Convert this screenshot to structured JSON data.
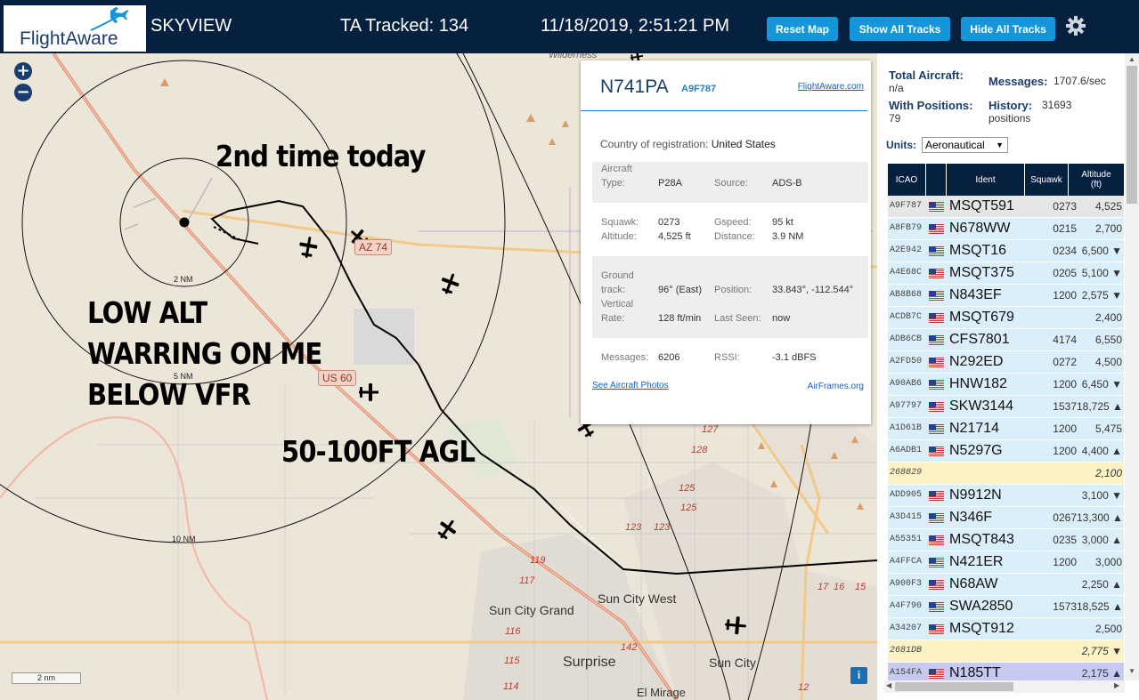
{
  "header": {
    "logo_text": "FlightAware",
    "title": "SKYVIEW",
    "tracked_label": "TA Tracked: 134",
    "datetime": "11/18/2019, 2:51:21 PM",
    "buttons": {
      "reset": "Reset Map",
      "show_all": "Show All Tracks",
      "hide_all": "Hide All Tracks"
    },
    "accent_color": "#1496d8",
    "bar_color": "#06203f"
  },
  "map": {
    "zoom_in": "+",
    "zoom_out": "−",
    "annotations": {
      "second_time": "2nd time today",
      "low_alt_1": "LOW ALT",
      "low_alt_2": "WARRING ON ME",
      "low_alt_3": "BELOW VFR",
      "agl": "50-100FT AGL"
    },
    "range_labels": {
      "r2": "2 NM",
      "r5": "5 NM",
      "r10": "10 NM"
    },
    "road_shields": {
      "az74": "AZ 74",
      "us60": "US 60"
    },
    "places": {
      "wilderness": "Wilderness",
      "sun_city_grand": "Sun City Grand",
      "sun_city_west": "Sun City West",
      "surprise": "Surprise",
      "sun_city": "Sun City",
      "el_mirage": "El Mirage"
    },
    "route_numbers": [
      "127",
      "128",
      "125",
      "125",
      "123",
      "123",
      "119",
      "117",
      "116",
      "115",
      "114",
      "142",
      "12",
      "17",
      "16",
      "15"
    ],
    "scale_label": "2 nm",
    "info_button": "i"
  },
  "popup": {
    "registration": "N741PA",
    "hex": "A9F787",
    "fa_link": "FlightAware.com",
    "country_label": "Country of registration:",
    "country_value": "United States",
    "aircraft_type_label_1": "Aircraft",
    "aircraft_type_label_2": "Type:",
    "aircraft_type": "P28A",
    "source_label": "Source:",
    "source": "ADS-B",
    "squawk_label": "Squawk:",
    "squawk": "0273",
    "gspeed_label": "Gspeed:",
    "gspeed": "95 kt",
    "altitude_label": "Altitude:",
    "altitude": "4,525 ft",
    "distance_label": "Distance:",
    "distance": "3.9 NM",
    "ground_label_1": "Ground",
    "ground_label_2": "track:",
    "ground_track": "96° (East)",
    "position_label": "Position:",
    "position": "33.843°, -112.544°",
    "vrate_label_1": "Vertical",
    "vrate_label_2": "Rate:",
    "vrate": "128 ft/min",
    "lastseen_label": "Last Seen:",
    "lastseen": "now",
    "messages_label": "Messages:",
    "messages": "6206",
    "rssi_label": "RSSI:",
    "rssi": "-3.1 dBFS",
    "photos_link": "See Aircraft Photos",
    "airframes_link": "AirFrames.org"
  },
  "sidebar": {
    "total_aircraft_label": "Total Aircraft:",
    "total_aircraft": "n/a",
    "messages_label": "Messages:",
    "messages": "1707.6/sec",
    "with_positions_label": "With Positions:",
    "with_positions": "79",
    "history_label": "History:",
    "history_1": "31693",
    "history_2": "positions",
    "units_label": "Units:",
    "units_value": "Aeronautical",
    "columns": {
      "icao": "ICAO",
      "ident": "Ident",
      "squawk": "Squawk",
      "alt_1": "Altitude",
      "alt_2": "(ft)"
    },
    "row_colors": {
      "default": "#dbeffb",
      "selected": "#e6e6e6",
      "no_position": "#fdf2c4",
      "highlight": "#c6c9f2"
    },
    "rows": [
      {
        "icao": "A9F787",
        "ident": "MSQT591",
        "squawk": "0273",
        "alt": "4,525",
        "state": "selected",
        "flag": true
      },
      {
        "icao": "A8FB79",
        "ident": "N678WW",
        "squawk": "0215",
        "alt": "2,700",
        "state": "default",
        "flag": true
      },
      {
        "icao": "A2E942",
        "ident": "MSQT16",
        "squawk": "0234",
        "alt": "6,500 ▼",
        "state": "default",
        "flag": true
      },
      {
        "icao": "A4E68C",
        "ident": "MSQT375",
        "squawk": "0205",
        "alt": "5,100 ▼",
        "state": "default",
        "flag": true
      },
      {
        "icao": "AB8B68",
        "ident": "N843EF",
        "squawk": "1200",
        "alt": "2,575 ▼",
        "state": "default",
        "flag": true
      },
      {
        "icao": "ACDB7C",
        "ident": "MSQT679",
        "squawk": "",
        "alt": "2,400",
        "state": "default",
        "flag": true
      },
      {
        "icao": "ADB6CB",
        "ident": "CFS7801",
        "squawk": "4174",
        "alt": "6,550",
        "state": "default",
        "flag": true
      },
      {
        "icao": "A2FD50",
        "ident": "N292ED",
        "squawk": "0272",
        "alt": "4,500",
        "state": "default",
        "flag": true
      },
      {
        "icao": "A90AB6",
        "ident": "HNW182",
        "squawk": "1200",
        "alt": "6,450 ▼",
        "state": "default",
        "flag": true
      },
      {
        "icao": "A97797",
        "ident": "SKW3144",
        "squawk": "1537",
        "alt": "18,725 ▲",
        "state": "default",
        "flag": true
      },
      {
        "icao": "A1D61B",
        "ident": "N21714",
        "squawk": "1200",
        "alt": "5,475",
        "state": "default",
        "flag": true
      },
      {
        "icao": "A6ADB1",
        "ident": "N5297G",
        "squawk": "1200",
        "alt": "4,400 ▲",
        "state": "default",
        "flag": true
      },
      {
        "icao": "268829",
        "ident": "",
        "squawk": "",
        "alt": "2,100",
        "state": "no_position",
        "flag": false
      },
      {
        "icao": "ADD905",
        "ident": "N9912N",
        "squawk": "",
        "alt": "3,100 ▼",
        "state": "default",
        "flag": true
      },
      {
        "icao": "A3D415",
        "ident": "N346F",
        "squawk": "0267",
        "alt": "13,300 ▲",
        "state": "default",
        "flag": true
      },
      {
        "icao": "A55351",
        "ident": "MSQT843",
        "squawk": "0235",
        "alt": "3,000 ▲",
        "state": "default",
        "flag": true
      },
      {
        "icao": "A4FFCA",
        "ident": "N421ER",
        "squawk": "1200",
        "alt": "3,000",
        "state": "default",
        "flag": true
      },
      {
        "icao": "A900F3",
        "ident": "N68AW",
        "squawk": "",
        "alt": "2,250 ▲",
        "state": "default",
        "flag": true
      },
      {
        "icao": "A4F790",
        "ident": "SWA2850",
        "squawk": "1573",
        "alt": "18,525 ▲",
        "state": "default",
        "flag": true
      },
      {
        "icao": "A34207",
        "ident": "MSQT912",
        "squawk": "",
        "alt": "2,500",
        "state": "default",
        "flag": true
      },
      {
        "icao": "2681DB",
        "ident": "",
        "squawk": "",
        "alt": "2,775 ▼",
        "state": "no_position",
        "flag": false
      },
      {
        "icao": "A154FA",
        "ident": "N185TT",
        "squawk": "",
        "alt": "2,175 ▲",
        "state": "highlight",
        "flag": true
      }
    ]
  }
}
